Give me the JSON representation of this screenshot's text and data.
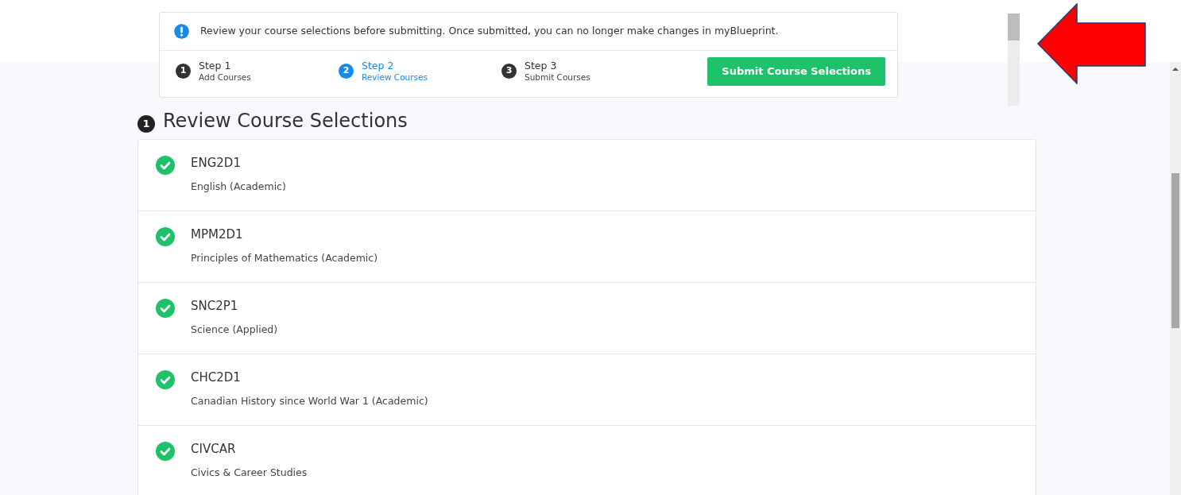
{
  "notice": {
    "text": "Review your course selections before submitting. Once submitted, you can no longer make changes in myBlueprint."
  },
  "steps": [
    {
      "number": "1",
      "title": "Step 1",
      "subtitle": "Add Courses",
      "selected": false
    },
    {
      "number": "2",
      "title": "Step 2",
      "subtitle": "Review Courses",
      "selected": true
    },
    {
      "number": "3",
      "title": "Step 3",
      "subtitle": "Submit Courses",
      "selected": false
    }
  ],
  "submit_button": "Submit Course Selections",
  "heading": {
    "number": "1",
    "text": "Review Course Selections"
  },
  "courses": [
    {
      "code": "ENG2D1",
      "name": "English (Academic)",
      "checked": true
    },
    {
      "code": "MPM2D1",
      "name": "Principles of Mathematics (Academic)",
      "checked": true
    },
    {
      "code": "SNC2P1",
      "name": "Science (Applied)",
      "checked": true
    },
    {
      "code": "CHC2D1",
      "name": "Canadian History since World War 1 (Academic)",
      "checked": true
    },
    {
      "code": "CIVCAR",
      "name": "Civics & Career Studies",
      "checked": true
    }
  ]
}
